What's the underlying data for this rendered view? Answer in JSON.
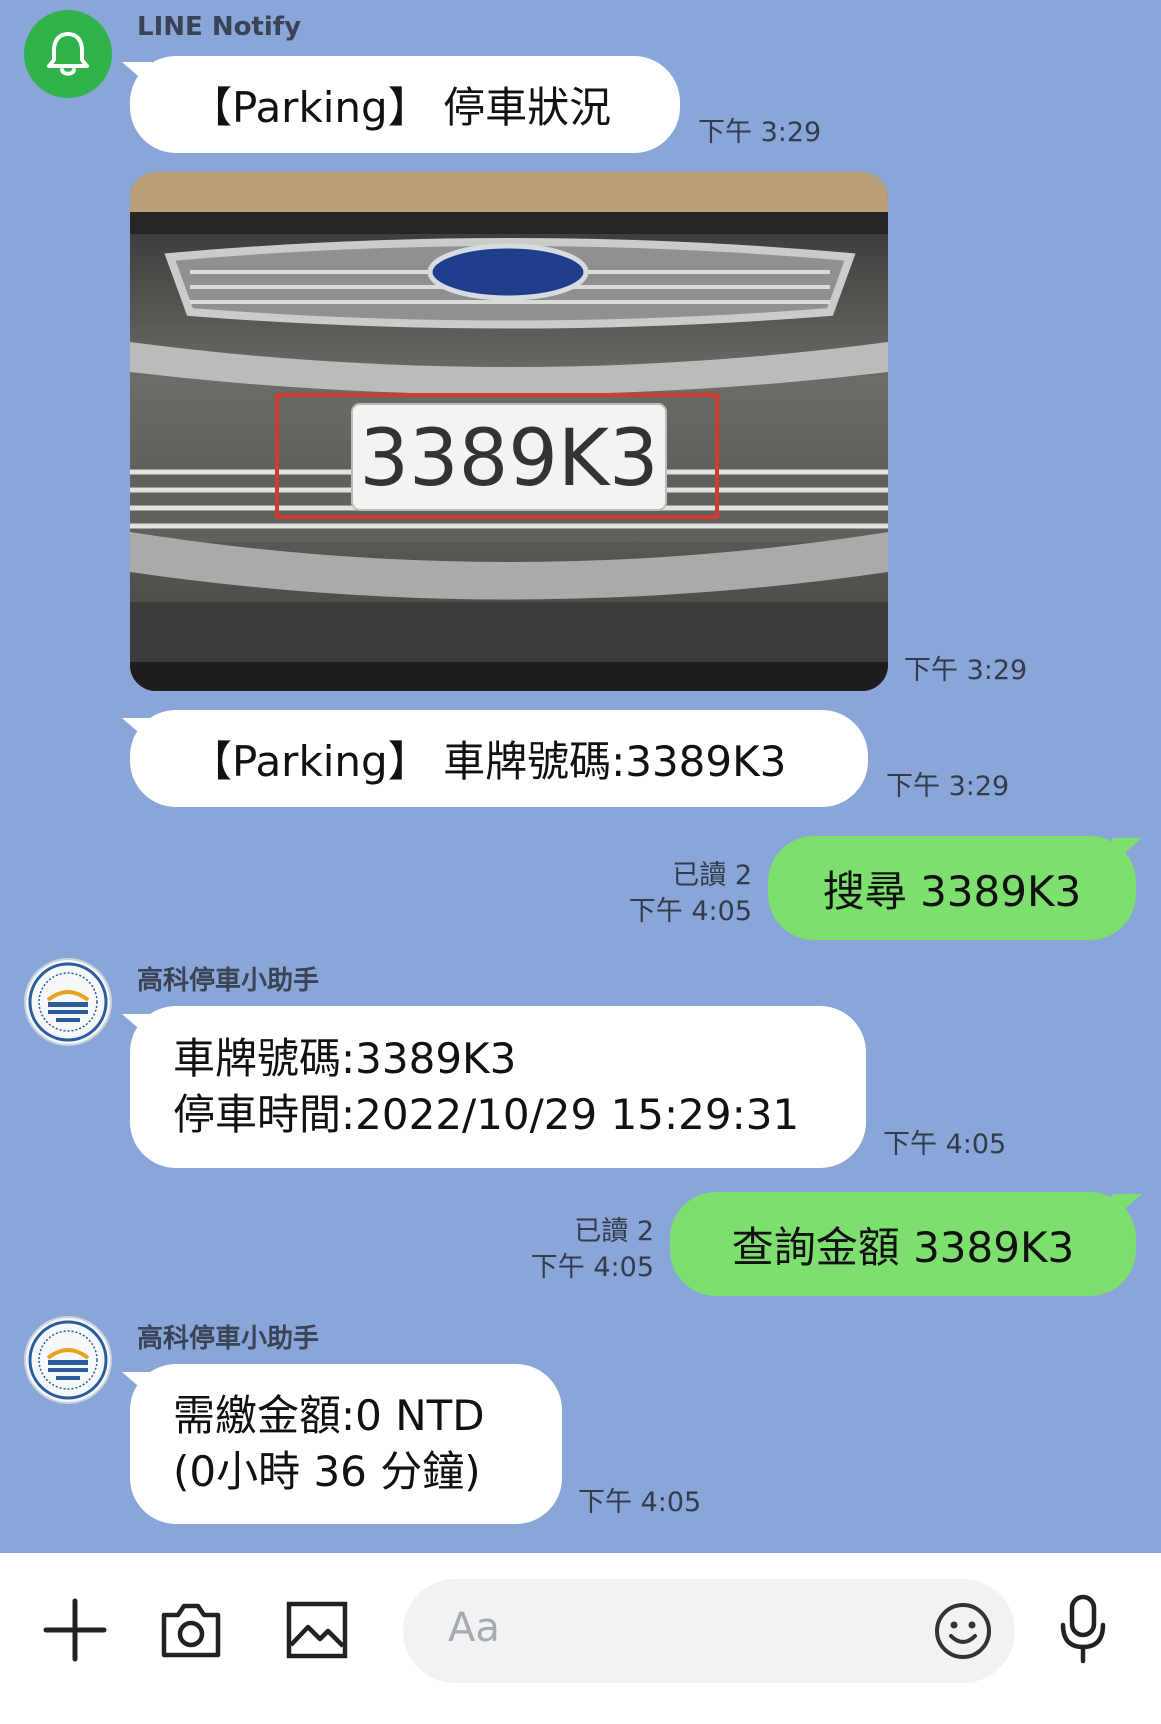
{
  "messages": [
    {
      "sender": "LINE Notify",
      "text": "【Parking】 停車狀況",
      "time": "下午 3:29"
    },
    {
      "photo_time": "下午 3:29",
      "plate_text": "3389K3",
      "car_brand": "Ford"
    },
    {
      "text": "【Parking】 車牌號碼:3389K3",
      "time": "下午 3:29"
    },
    {
      "text": "搜尋 3389K3",
      "read": "已讀 2",
      "time": "下午 4:05"
    },
    {
      "sender": "高科停車小助手",
      "line1": "車牌號碼:3389K3",
      "line2": "停車時間:2022/10/29 15:29:31",
      "time": "下午 4:05"
    },
    {
      "text": "查詢金額 3389K3",
      "read": "已讀 2",
      "time": "下午 4:05"
    },
    {
      "sender": "高科停車小助手",
      "line1": "需繳金額:0 NTD",
      "line2": "(0小時 36 分鐘)",
      "time": "下午 4:05"
    }
  ],
  "input": {
    "placeholder": "Aa"
  },
  "icons": [
    "plus-icon",
    "camera-icon",
    "image-icon",
    "emoji-icon",
    "microphone-icon"
  ],
  "colors": {
    "background": "#8aa5d7",
    "own_bubble": "#7ddf6e",
    "notify_green": "#2fb34a"
  }
}
